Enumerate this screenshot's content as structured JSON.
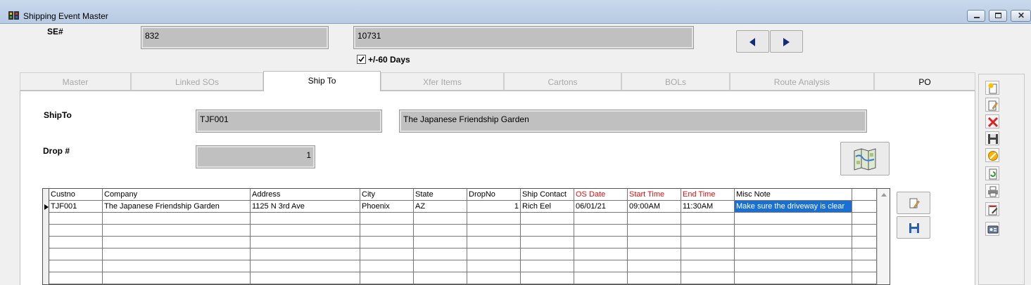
{
  "window": {
    "title": "Shipping Event Master"
  },
  "header": {
    "se_label": "SE#",
    "se_value": "832",
    "se_value2": "10731",
    "days_label": "+/-60 Days"
  },
  "tabs": [
    {
      "label": "Master"
    },
    {
      "label": "Linked SOs"
    },
    {
      "label": "Ship To"
    },
    {
      "label": "Xfer Items"
    },
    {
      "label": "Cartons"
    },
    {
      "label": "BOLs"
    },
    {
      "label": "Route Analysis"
    },
    {
      "label": "PO"
    }
  ],
  "shipto": {
    "label": "ShipTo",
    "code": "TJF001",
    "name": "The Japanese Friendship Garden",
    "drop_label": "Drop #",
    "drop_value": "1"
  },
  "grid": {
    "columns": [
      "Custno",
      "Company",
      "Address",
      "City",
      "State",
      "DropNo",
      "Ship Contact",
      "OS Date",
      "Start Time",
      "End Time",
      "Misc Note"
    ],
    "rows": [
      [
        "TJF001",
        "The Japanese Friendship Garden",
        "1125 N 3rd Ave",
        "Phoenix",
        "AZ",
        "1",
        "Rich Eel",
        "06/01/21",
        "09:00AM",
        "11:30AM",
        "Make sure the driveway is clear"
      ]
    ]
  },
  "colors": {
    "accent": "#1a6fd4",
    "required": "#d11111"
  }
}
